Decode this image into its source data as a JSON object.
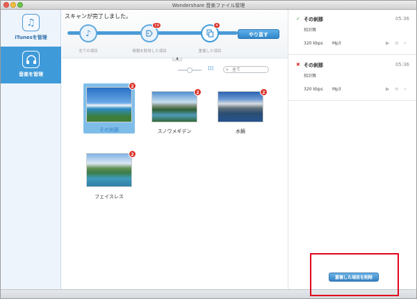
{
  "window": {
    "title": "Wondershare 音楽ファイル管理"
  },
  "sidebar": {
    "items": [
      {
        "label": "iTunesを管理",
        "icon": "music-note-icon"
      },
      {
        "label": "音楽を管理",
        "icon": "headphones-icon"
      }
    ]
  },
  "scan": {
    "message": "スキャンが完了しました。",
    "steps": [
      {
        "label": "全ての項目",
        "icon": "music-note-icon",
        "badge": ""
      },
      {
        "label": "情報を取得した項目",
        "icon": "tag-icon",
        "badge": "19"
      },
      {
        "label": "重複した項目",
        "icon": "copy-icon",
        "badge": "4"
      }
    ],
    "redo_label": "やり直す",
    "collapse_glyph": "▲"
  },
  "toolbar": {
    "grid_glyph": "⁞⁞⁞",
    "search_placeholder": "全て"
  },
  "albums": [
    {
      "label": "その刹那",
      "count": "2",
      "selected": true
    },
    {
      "label": "スノウメギデン",
      "count": "2",
      "selected": false
    },
    {
      "label": "水鏡",
      "count": "2",
      "selected": false
    },
    {
      "label": "フェイスレス",
      "count": "2",
      "selected": false
    }
  ],
  "duplicates": [
    {
      "mark": "✓",
      "mark_color": "#3fa94b",
      "title": "その刹那",
      "time": "05:36",
      "artist": "相沢舞",
      "bitrate": "320 kbps",
      "format": "Mp3"
    },
    {
      "mark": "✖",
      "mark_color": "#d9342b",
      "title": "その刹那",
      "time": "05:36",
      "artist": "相沢舞",
      "bitrate": "320 kbps",
      "format": "Mp3"
    }
  ],
  "delete_label": "重複した項目を削除",
  "colors": {
    "accent": "#3f9ad9",
    "badge": "#d9342b",
    "highlight": "#e0001b"
  }
}
